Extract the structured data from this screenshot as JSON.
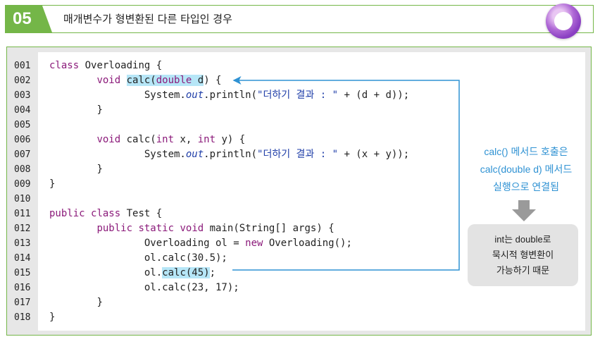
{
  "header": {
    "number": "05",
    "title": "매개변수가 형변환된 다른 타입인 경우"
  },
  "line_numbers": [
    "001",
    "002",
    "003",
    "004",
    "005",
    "006",
    "007",
    "008",
    "009",
    "010",
    "011",
    "012",
    "013",
    "014",
    "015",
    "016",
    "017",
    "018"
  ],
  "code": {
    "l1": {
      "kw": "class",
      "rest": " Overloading {"
    },
    "l2": {
      "indent": "        ",
      "kw": "void",
      "sp": " ",
      "hl_a": "calc(",
      "hl_kw": "double",
      "hl_b": " d",
      "rest": ") {"
    },
    "l3": {
      "indent": "                ",
      "a": "System.",
      "fld": "out",
      "b": ".println(",
      "str": "\"더하기 결과 : \"",
      "rest": " + (d + d));"
    },
    "l4": {
      "indent": "        ",
      "text": "}"
    },
    "l6": {
      "indent": "        ",
      "kw": "void",
      "a": " calc(",
      "kw2": "int",
      "b": " x, ",
      "kw3": "int",
      "rest": " y) {"
    },
    "l7": {
      "indent": "                ",
      "a": "System.",
      "fld": "out",
      "b": ".println(",
      "str": "\"더하기 결과 : \"",
      "rest": " + (x + y));"
    },
    "l8": {
      "indent": "        ",
      "text": "}"
    },
    "l9": {
      "text": "}"
    },
    "l11": {
      "kw": "public",
      "a": " ",
      "kw2": "class",
      "rest": " Test {"
    },
    "l12": {
      "indent": "        ",
      "kw": "public",
      "a": " ",
      "kw2": "static",
      "b": " ",
      "kw3": "void",
      "rest": " main(String[] args) {"
    },
    "l13": {
      "indent": "                ",
      "a": "Overloading ol = ",
      "kw": "new",
      "rest": " Overloading();"
    },
    "l14": {
      "indent": "                ",
      "text": "ol.calc(30.5);"
    },
    "l15": {
      "indent": "                ",
      "a": "ol.",
      "hl": "calc(45)",
      "rest": ";"
    },
    "l16": {
      "indent": "                ",
      "text": "ol.calc(23, 17);"
    },
    "l17": {
      "indent": "        ",
      "text": "}"
    },
    "l18": {
      "text": "}"
    }
  },
  "annotation": {
    "line1": "calc() 메서드 호출은",
    "line2": "calc(double d) 메서드",
    "line3": "실행으로 연결됨"
  },
  "note": {
    "line1": "int는 double로",
    "line2": "묵시적 형변환이",
    "line3": "가능하기 때문"
  },
  "colors": {
    "accent_green": "#74b648",
    "annotation_blue": "#2f92d3",
    "highlight": "#b6e6f7",
    "keyword": "#8b1a7a",
    "string": "#1f3ea8"
  }
}
